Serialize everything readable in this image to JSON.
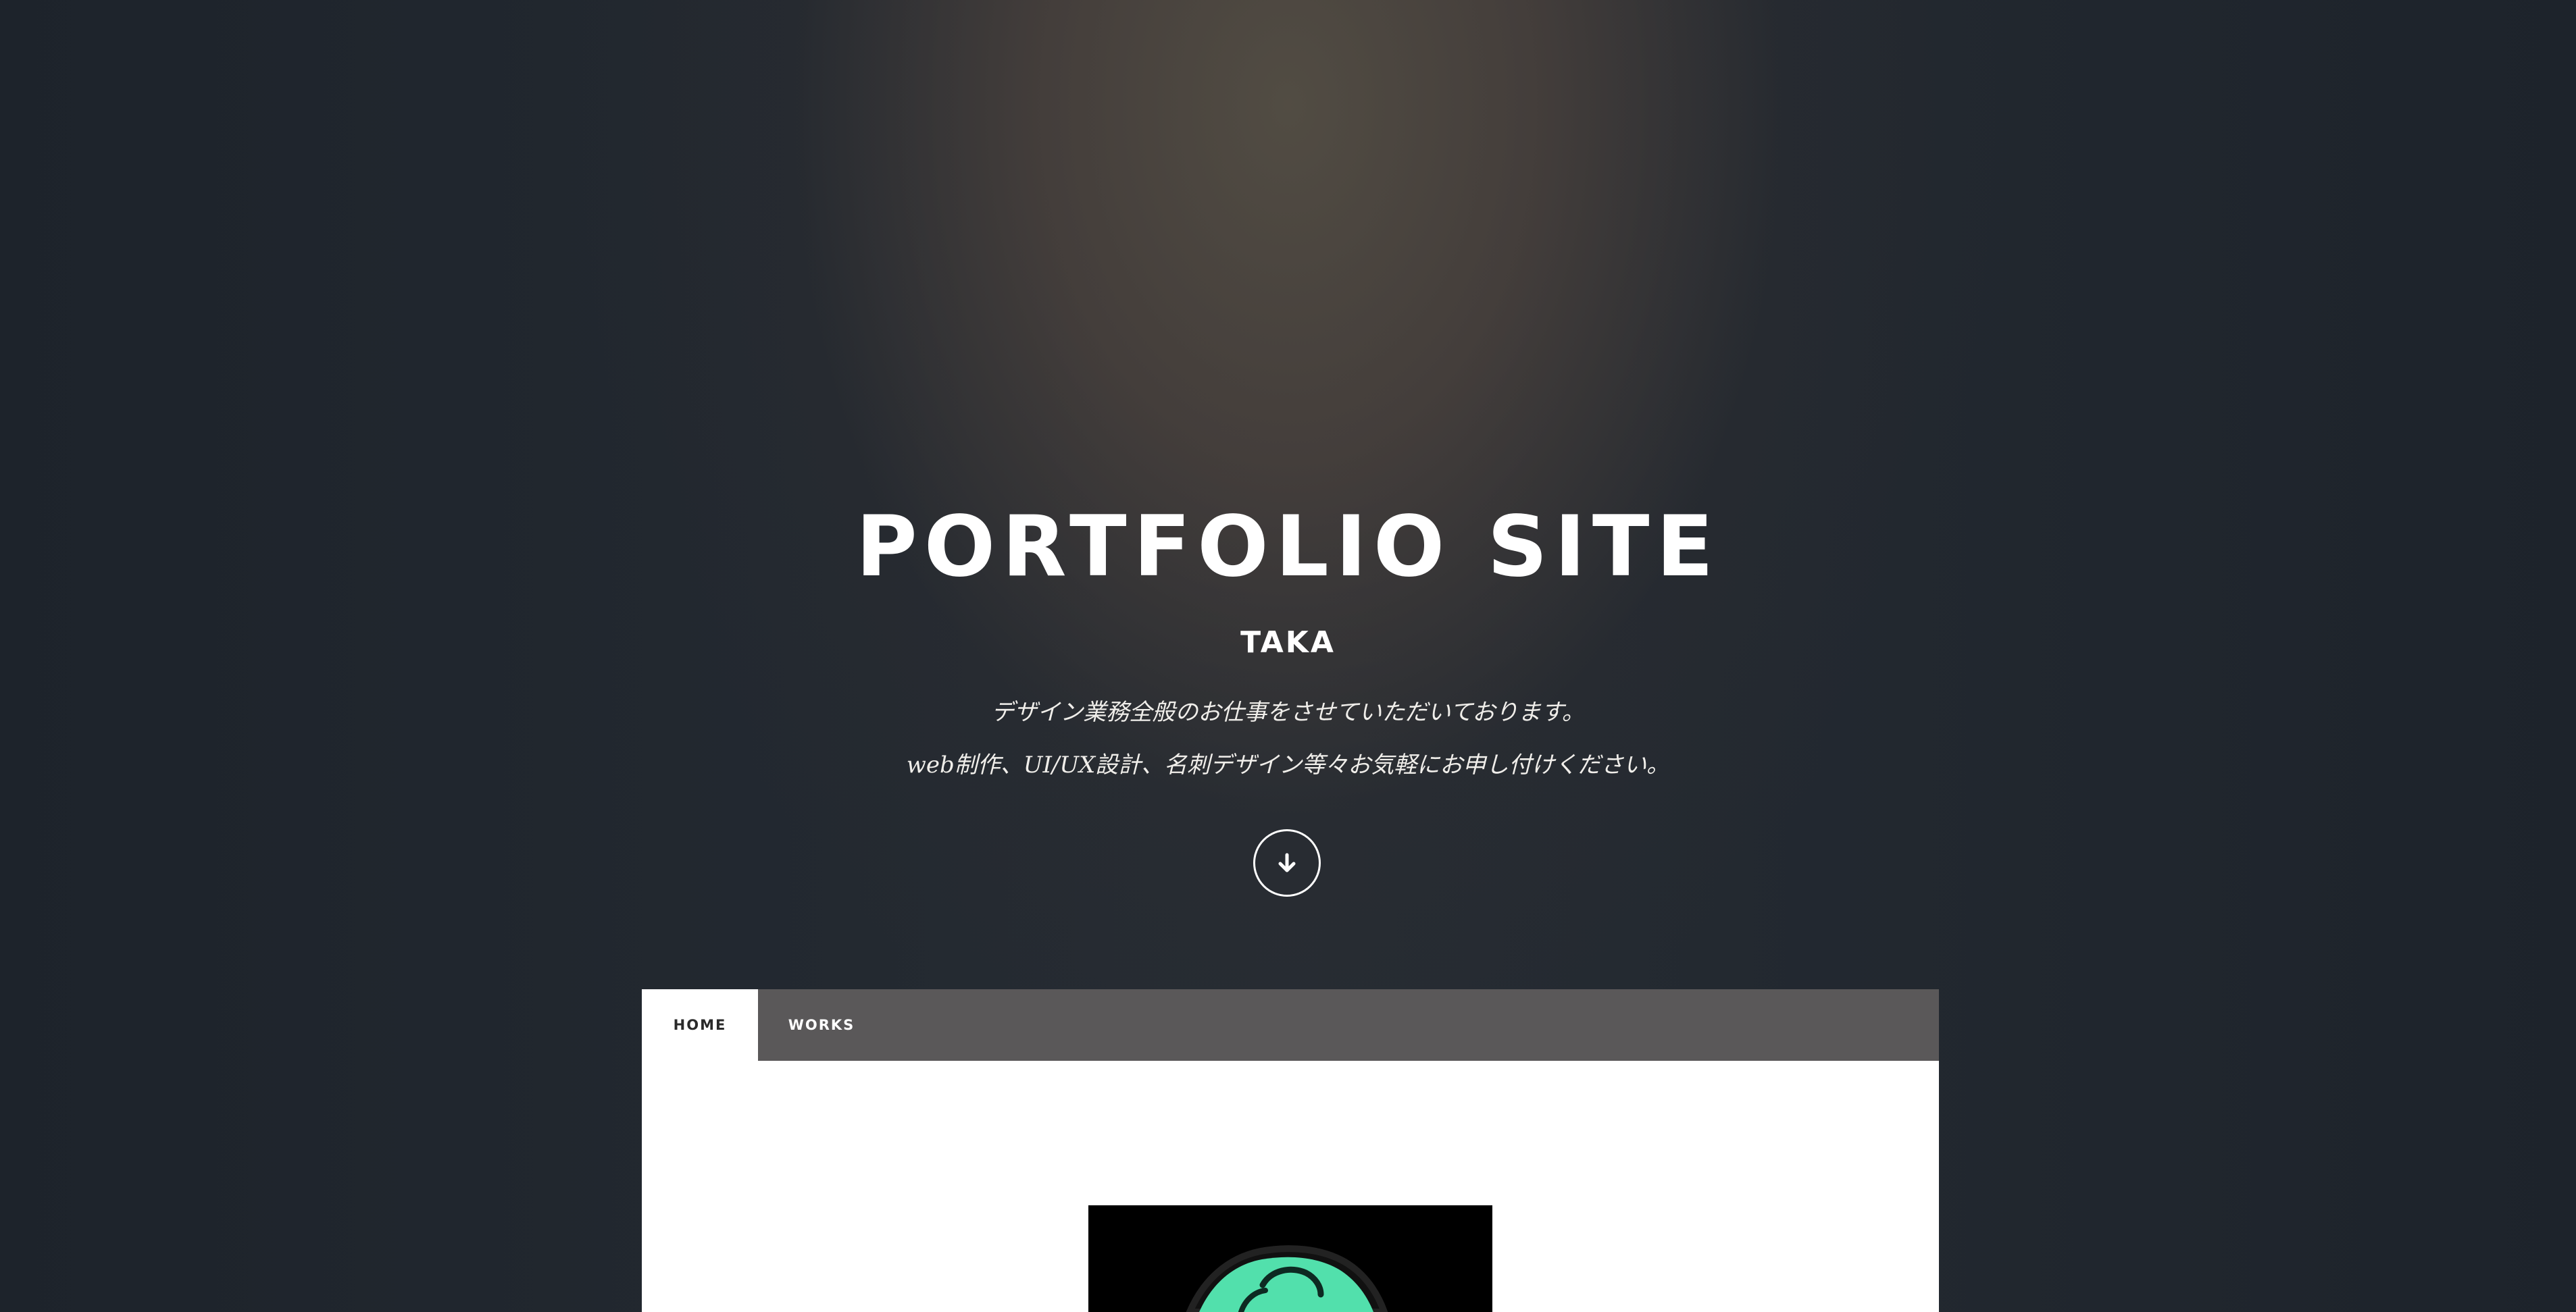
{
  "hero": {
    "title": "PORTFOLIO SITE",
    "name": "TAKA",
    "description_line1": "デザイン業務全般のお仕事をさせていただいております。",
    "description_line2": "web制作、UI/UX設計、名刺デザイン等々お気軽にお申し付けください。",
    "scroll_icon": "arrow-down-icon"
  },
  "nav": {
    "tabs": [
      {
        "label": "HOME",
        "active": true
      },
      {
        "label": "WORKS",
        "active": false
      }
    ]
  },
  "colors": {
    "tab_bar": "#5a5859",
    "active_tab": "#ffffff",
    "artwork_fill": "#52e0ac",
    "artwork_background": "#000000"
  }
}
